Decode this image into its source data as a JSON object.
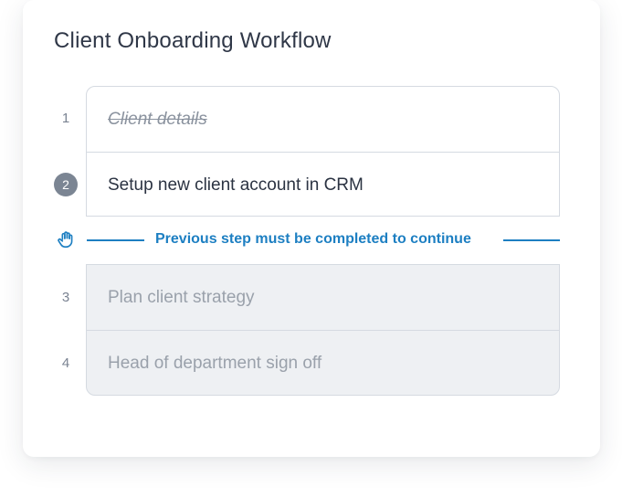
{
  "workflow": {
    "title": "Client Onboarding Workflow",
    "accent_color": "#1d7fc2",
    "steps": [
      {
        "number": "1",
        "label": "Client details",
        "status": "completed"
      },
      {
        "number": "2",
        "label": "Setup new client account in CRM",
        "status": "current"
      },
      {
        "number": "3",
        "label": "Plan client strategy",
        "status": "locked"
      },
      {
        "number": "4",
        "label": "Head of department sign off",
        "status": "locked"
      }
    ],
    "gate": {
      "icon": "hand-stop-icon",
      "message": "Previous step must be completed to continue"
    }
  }
}
